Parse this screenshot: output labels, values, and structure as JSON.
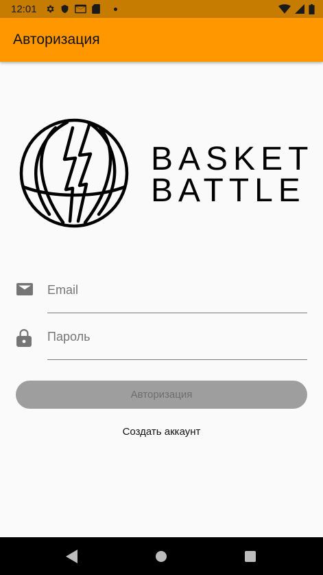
{
  "status_bar": {
    "time": "12:01",
    "icons": [
      "gear-icon",
      "shield-icon",
      "mail-icon",
      "sd-card-icon",
      "dot-icon",
      "wifi-icon",
      "battery-icon"
    ]
  },
  "app_bar": {
    "title": "Авторизация",
    "color": "#ff9800"
  },
  "logo": {
    "line1": "BASKET",
    "line2": "BATTLE"
  },
  "form": {
    "email": {
      "placeholder": "Email",
      "value": "",
      "icon": "mail-icon"
    },
    "password": {
      "placeholder": "Пароль",
      "value": "",
      "icon": "lock-icon"
    },
    "login_label": "Авторизация",
    "register_label": "Создать аккаунт"
  },
  "nav_bar": {
    "buttons": [
      "back-icon",
      "home-icon",
      "recents-icon"
    ]
  }
}
